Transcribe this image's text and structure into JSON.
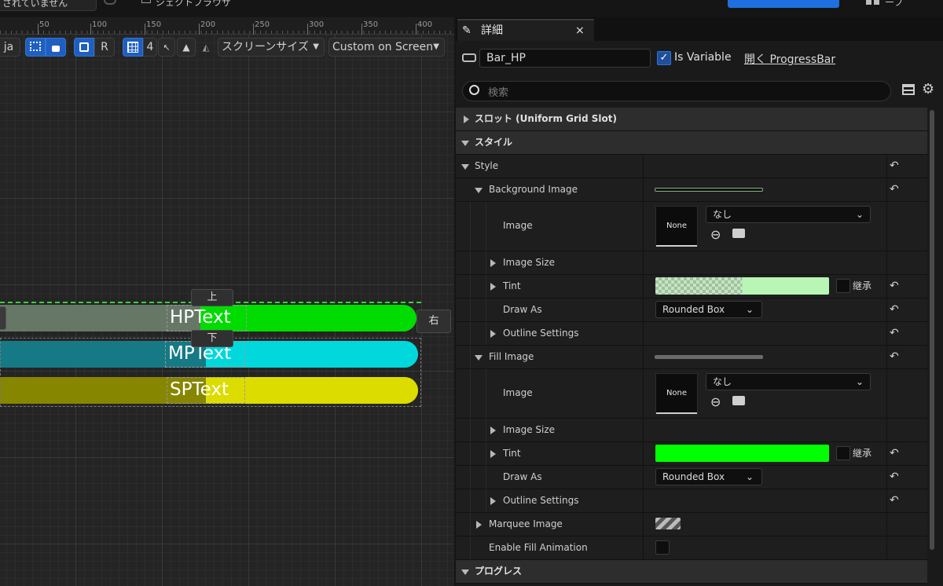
{
  "top_bar": {
    "dropdown_text": "されていません",
    "title_text": "ジェクトブラウザ",
    "right_text": "ーフ"
  },
  "ruler": {
    "marks": [
      "50",
      "100",
      "150",
      "200",
      "250",
      "300",
      "350",
      "400"
    ]
  },
  "canvas_toolbar": {
    "lang": "ja",
    "resolution_mode": "R",
    "grid_count": "4",
    "screen_size_label": "スクリーンサイズ",
    "screen_mode_label": "Custom on Screen"
  },
  "canvas": {
    "bars": [
      {
        "text": "HPText",
        "fill_color": "#00dc00",
        "bg_color": "#667766",
        "percent": 0.5
      },
      {
        "text": "MPText",
        "fill_color": "#00d8dc",
        "bg_color": "#157a85",
        "percent": 0.5
      },
      {
        "text": "SPText",
        "fill_color": "#dcdc00",
        "bg_color": "#868600",
        "percent": 0.5
      }
    ],
    "anchors": {
      "top": "上",
      "bottom": "下",
      "right": "右"
    }
  },
  "details": {
    "tab_label": "詳細",
    "close_label": "×",
    "name_value": "Bar_HP",
    "is_variable_label": "Is Variable",
    "is_variable_checked": true,
    "open_link": "開く ProgressBar",
    "search_placeholder": "検索",
    "rows": {
      "slot": "スロット (Uniform Grid Slot)",
      "style_cat": "スタイル",
      "style": "Style",
      "background_image": "Background Image",
      "bg_image": "Image",
      "bg_none": "None",
      "bg_asset": "なし",
      "bg_image_size": "Image Size",
      "bg_tint": "Tint",
      "bg_tint_inherit": "継承",
      "bg_draw_as_label": "Draw As",
      "bg_draw_as_value": "Rounded Box",
      "bg_outline": "Outline Settings",
      "fill_image": "Fill Image",
      "fill_img": "Image",
      "fill_none": "None",
      "fill_asset": "なし",
      "fill_image_size": "Image Size",
      "fill_tint": "Tint",
      "fill_tint_inherit": "継承",
      "fill_draw_as_label": "Draw As",
      "fill_draw_as_value": "Rounded Box",
      "fill_outline": "Outline Settings",
      "marquee": "Marquee Image",
      "enable_fill_anim": "Enable Fill Animation",
      "progress_cat": "プログレス"
    },
    "colors": {
      "bg_tint": "#b9f5b5",
      "fill_tint": "#00ff00",
      "accent": "#2f74d8"
    }
  }
}
